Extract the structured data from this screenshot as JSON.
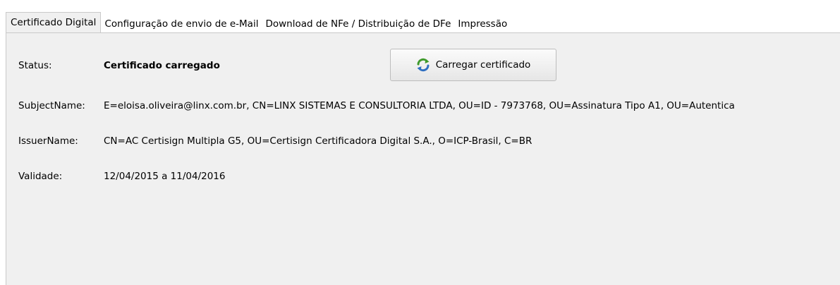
{
  "tabs": [
    {
      "label": "Certificado Digital"
    },
    {
      "label": "Configuração de envio de e-Mail"
    },
    {
      "label": "Download de NFe / Distribuição de DFe"
    },
    {
      "label": "Impressão"
    }
  ],
  "certificate": {
    "status_label": "Status:",
    "status_value": "Certificado carregado",
    "subject_label": "SubjectName:",
    "subject_value": "E=eloisa.oliveira@linx.com.br, CN=LINX SISTEMAS E CONSULTORIA LTDA, OU=ID - 7973768, OU=Assinatura Tipo A1, OU=Autentica",
    "issuer_label": "IssuerName:",
    "issuer_value": "CN=AC Certisign Multipla G5, OU=Certisign Certificadora Digital S.A., O=ICP-Brasil, C=BR",
    "validade_label": "Validade:",
    "validade_value": "12/04/2015 a 11/04/2016"
  },
  "load_button": {
    "label": "Carregar certificado",
    "icon": "refresh-icon"
  },
  "colors": {
    "panel_bg": "#f0f0f0",
    "border": "#c9c9c9",
    "icon_green": "#3f9a2c",
    "icon_blue": "#2f6fc1"
  }
}
